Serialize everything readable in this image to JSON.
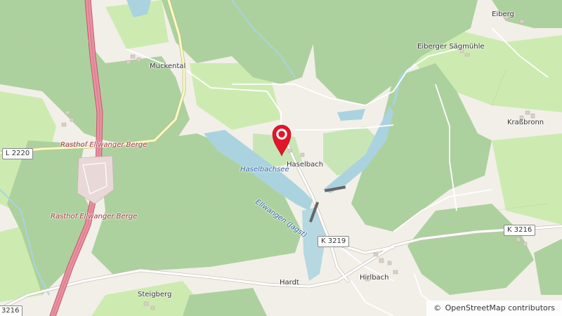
{
  "map": {
    "colors": {
      "background": "#f2efe9",
      "forest": "#add19e",
      "forest_dark": "#8fbf83",
      "meadow": "#cdebb0",
      "water": "#aad3df",
      "motorway": "#e892a2",
      "primary_road": "#ffffff",
      "secondary_road": "#f7fabf",
      "pin": "#e0162b"
    },
    "places": {
      "eiberg": "Eiberg",
      "eiberger_saegmuehle": "Eiberger Sägmühle",
      "muckental": "Muckental",
      "krassbronn": "Kraßbronn",
      "haselbach": "Haselbach",
      "hardt": "Hardt",
      "hirlbach": "Hirlbach",
      "steigberg": "Steigberg"
    },
    "rest_areas": {
      "north": "Rasthof Ellwanger Berge",
      "south": "Rasthof Ellwanger Berge"
    },
    "water": {
      "lake": "Haselbachsee",
      "river": "Ellwangen (Jagst)"
    },
    "road_refs": {
      "l2220": "L 2220",
      "k3219": "K 3219",
      "k3216_east": "K 3216",
      "k3216_west": "3216"
    },
    "marker": {
      "icon": "map-pin-icon"
    }
  },
  "attribution": {
    "copyright_symbol": "©",
    "text": "OpenStreetMap contributors"
  }
}
